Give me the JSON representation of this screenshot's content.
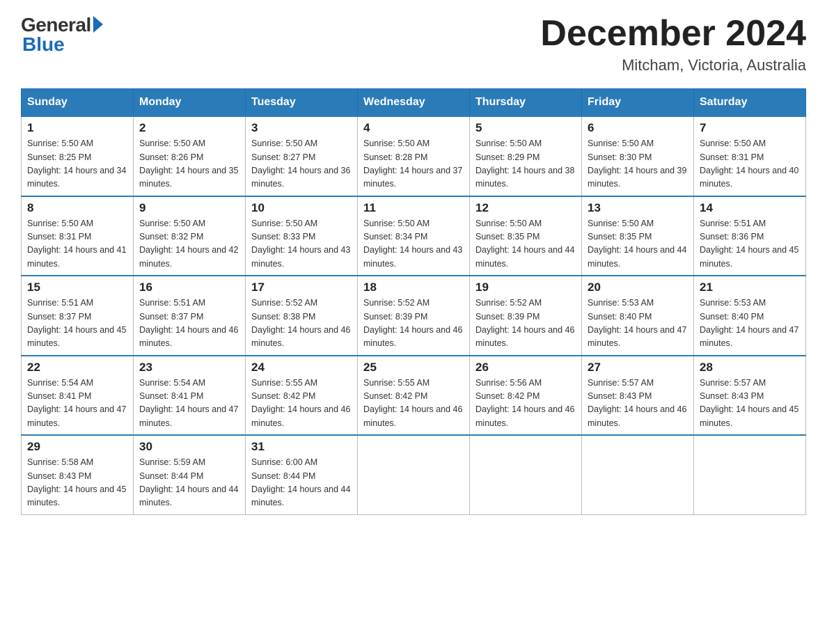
{
  "logo": {
    "general": "General",
    "blue": "Blue"
  },
  "title": "December 2024",
  "location": "Mitcham, Victoria, Australia",
  "days_of_week": [
    "Sunday",
    "Monday",
    "Tuesday",
    "Wednesday",
    "Thursday",
    "Friday",
    "Saturday"
  ],
  "weeks": [
    [
      {
        "day": "1",
        "sunrise": "5:50 AM",
        "sunset": "8:25 PM",
        "daylight": "14 hours and 34 minutes."
      },
      {
        "day": "2",
        "sunrise": "5:50 AM",
        "sunset": "8:26 PM",
        "daylight": "14 hours and 35 minutes."
      },
      {
        "day": "3",
        "sunrise": "5:50 AM",
        "sunset": "8:27 PM",
        "daylight": "14 hours and 36 minutes."
      },
      {
        "day": "4",
        "sunrise": "5:50 AM",
        "sunset": "8:28 PM",
        "daylight": "14 hours and 37 minutes."
      },
      {
        "day": "5",
        "sunrise": "5:50 AM",
        "sunset": "8:29 PM",
        "daylight": "14 hours and 38 minutes."
      },
      {
        "day": "6",
        "sunrise": "5:50 AM",
        "sunset": "8:30 PM",
        "daylight": "14 hours and 39 minutes."
      },
      {
        "day": "7",
        "sunrise": "5:50 AM",
        "sunset": "8:31 PM",
        "daylight": "14 hours and 40 minutes."
      }
    ],
    [
      {
        "day": "8",
        "sunrise": "5:50 AM",
        "sunset": "8:31 PM",
        "daylight": "14 hours and 41 minutes."
      },
      {
        "day": "9",
        "sunrise": "5:50 AM",
        "sunset": "8:32 PM",
        "daylight": "14 hours and 42 minutes."
      },
      {
        "day": "10",
        "sunrise": "5:50 AM",
        "sunset": "8:33 PM",
        "daylight": "14 hours and 43 minutes."
      },
      {
        "day": "11",
        "sunrise": "5:50 AM",
        "sunset": "8:34 PM",
        "daylight": "14 hours and 43 minutes."
      },
      {
        "day": "12",
        "sunrise": "5:50 AM",
        "sunset": "8:35 PM",
        "daylight": "14 hours and 44 minutes."
      },
      {
        "day": "13",
        "sunrise": "5:50 AM",
        "sunset": "8:35 PM",
        "daylight": "14 hours and 44 minutes."
      },
      {
        "day": "14",
        "sunrise": "5:51 AM",
        "sunset": "8:36 PM",
        "daylight": "14 hours and 45 minutes."
      }
    ],
    [
      {
        "day": "15",
        "sunrise": "5:51 AM",
        "sunset": "8:37 PM",
        "daylight": "14 hours and 45 minutes."
      },
      {
        "day": "16",
        "sunrise": "5:51 AM",
        "sunset": "8:37 PM",
        "daylight": "14 hours and 46 minutes."
      },
      {
        "day": "17",
        "sunrise": "5:52 AM",
        "sunset": "8:38 PM",
        "daylight": "14 hours and 46 minutes."
      },
      {
        "day": "18",
        "sunrise": "5:52 AM",
        "sunset": "8:39 PM",
        "daylight": "14 hours and 46 minutes."
      },
      {
        "day": "19",
        "sunrise": "5:52 AM",
        "sunset": "8:39 PM",
        "daylight": "14 hours and 46 minutes."
      },
      {
        "day": "20",
        "sunrise": "5:53 AM",
        "sunset": "8:40 PM",
        "daylight": "14 hours and 47 minutes."
      },
      {
        "day": "21",
        "sunrise": "5:53 AM",
        "sunset": "8:40 PM",
        "daylight": "14 hours and 47 minutes."
      }
    ],
    [
      {
        "day": "22",
        "sunrise": "5:54 AM",
        "sunset": "8:41 PM",
        "daylight": "14 hours and 47 minutes."
      },
      {
        "day": "23",
        "sunrise": "5:54 AM",
        "sunset": "8:41 PM",
        "daylight": "14 hours and 47 minutes."
      },
      {
        "day": "24",
        "sunrise": "5:55 AM",
        "sunset": "8:42 PM",
        "daylight": "14 hours and 46 minutes."
      },
      {
        "day": "25",
        "sunrise": "5:55 AM",
        "sunset": "8:42 PM",
        "daylight": "14 hours and 46 minutes."
      },
      {
        "day": "26",
        "sunrise": "5:56 AM",
        "sunset": "8:42 PM",
        "daylight": "14 hours and 46 minutes."
      },
      {
        "day": "27",
        "sunrise": "5:57 AM",
        "sunset": "8:43 PM",
        "daylight": "14 hours and 46 minutes."
      },
      {
        "day": "28",
        "sunrise": "5:57 AM",
        "sunset": "8:43 PM",
        "daylight": "14 hours and 45 minutes."
      }
    ],
    [
      {
        "day": "29",
        "sunrise": "5:58 AM",
        "sunset": "8:43 PM",
        "daylight": "14 hours and 45 minutes."
      },
      {
        "day": "30",
        "sunrise": "5:59 AM",
        "sunset": "8:44 PM",
        "daylight": "14 hours and 44 minutes."
      },
      {
        "day": "31",
        "sunrise": "6:00 AM",
        "sunset": "8:44 PM",
        "daylight": "14 hours and 44 minutes."
      },
      null,
      null,
      null,
      null
    ]
  ]
}
